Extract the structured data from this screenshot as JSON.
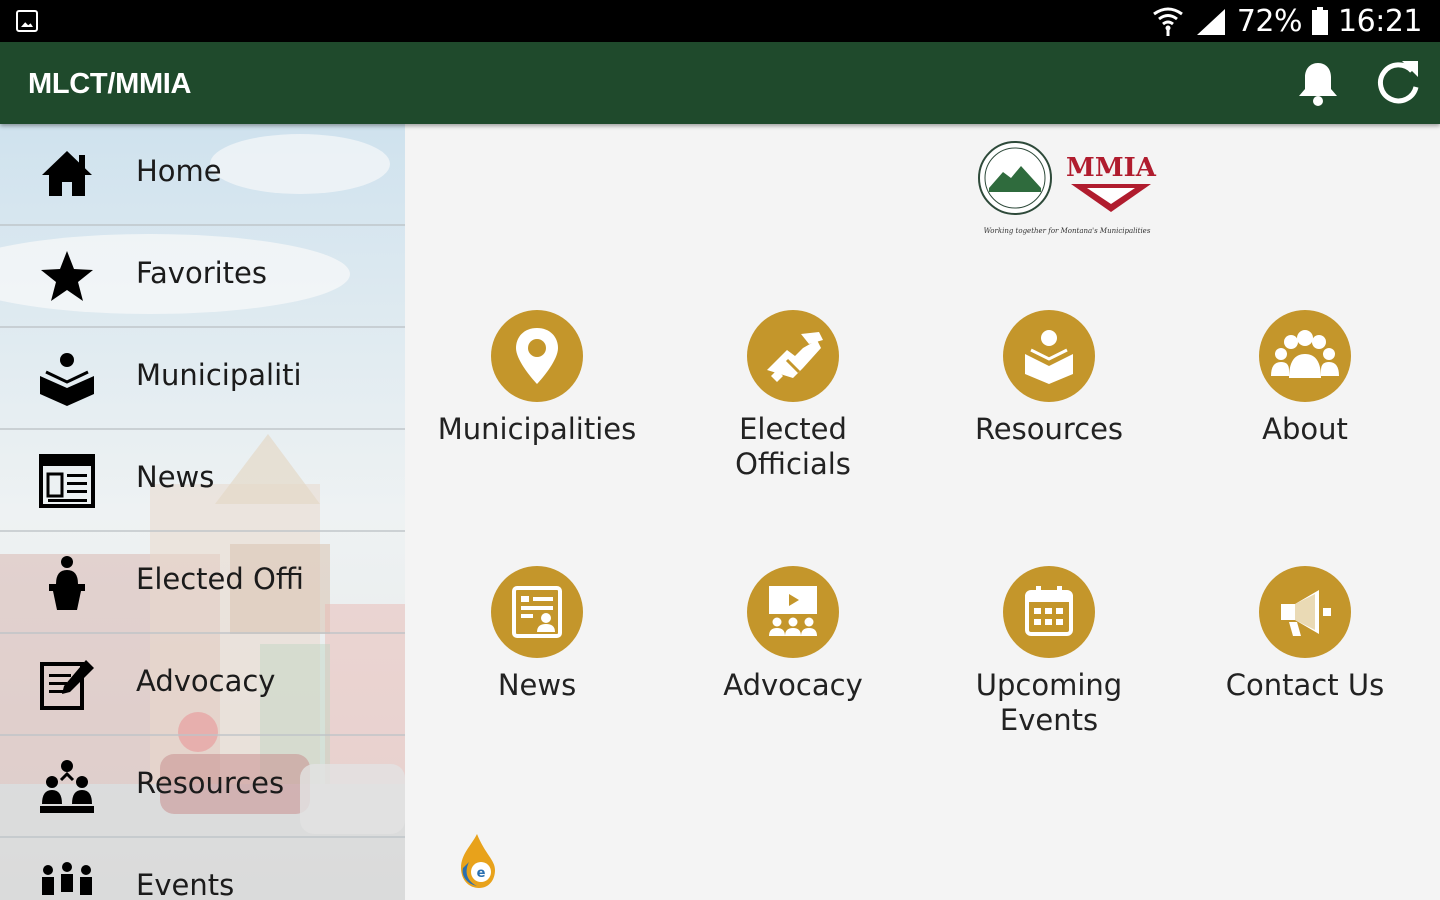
{
  "status": {
    "battery": "72%",
    "time": "16:21"
  },
  "appbar": {
    "title": "MLCT/MMIA",
    "icons": [
      "bell-icon",
      "refresh-icon"
    ]
  },
  "drawer": {
    "items": [
      {
        "label": "Home",
        "icon": "home-icon"
      },
      {
        "label": "Favorites",
        "icon": "star-icon"
      },
      {
        "label": "Municipaliti",
        "icon": "municipalities-icon"
      },
      {
        "label": "News",
        "icon": "newspaper-icon"
      },
      {
        "label": "Elected Offi",
        "icon": "podium-icon"
      },
      {
        "label": "Advocacy",
        "icon": "edit-note-icon"
      },
      {
        "label": "Resources",
        "icon": "group-resources-icon"
      },
      {
        "label": "Events",
        "icon": "events-group-icon"
      }
    ]
  },
  "main": {
    "logo": {
      "text": "MMIA",
      "tagline": "Working together for Montana's Municipalities"
    },
    "tiles": [
      {
        "label": "Municipalities",
        "icon": "map-pin-icon"
      },
      {
        "label": "Elected Officials",
        "icon": "handshake-icon"
      },
      {
        "label": "Resources",
        "icon": "open-book-icon"
      },
      {
        "label": "About",
        "icon": "people-icon"
      },
      {
        "label": "News",
        "icon": "news-icon"
      },
      {
        "label": "Advocacy",
        "icon": "presentation-icon"
      },
      {
        "label": "Upcoming Events",
        "icon": "calendar-icon"
      },
      {
        "label": "Contact Us",
        "icon": "megaphone-icon"
      }
    ]
  },
  "colors": {
    "appbar": "#1f4a2c",
    "accent": "#c4962b",
    "statusbar": "#000000",
    "background": "#f4f4f4"
  }
}
